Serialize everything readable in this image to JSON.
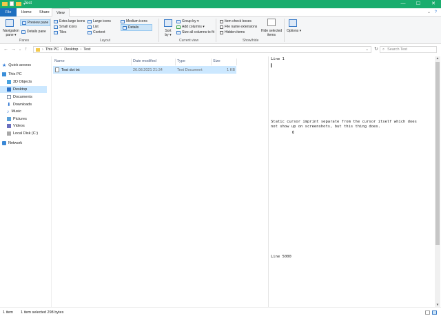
{
  "window": {
    "title": "Test",
    "controls": [
      "—",
      "☐",
      "✕"
    ]
  },
  "ribbon_tabs": [
    {
      "label": "File"
    },
    {
      "label": "Home"
    },
    {
      "label": "Share"
    },
    {
      "label": "View"
    }
  ],
  "ribbon": {
    "panes": {
      "navigation_pane": "Navigation pane ▾",
      "preview_pane": "Preview pane",
      "details_pane": "Details pane",
      "group_label": "Panes"
    },
    "layout": {
      "items": [
        "Extra large icons",
        "Large icons",
        "Medium icons",
        "Small icons",
        "List",
        "Details",
        "Tiles",
        "Content"
      ],
      "selected": "Details",
      "group_label": "Layout"
    },
    "current_view": {
      "sort_by": "Sort by ▾",
      "group_by": "Group by ▾",
      "add_columns": "Add columns ▾",
      "size_all": "Size all columns to fit",
      "group_label": "Current view"
    },
    "show_hide": {
      "item_checkboxes": "Item check boxes",
      "file_name_extensions": "File name extensions",
      "hidden_items": "Hidden items",
      "hide_selected": "Hide selected items",
      "group_label": "Show/hide"
    },
    "options": "Options ▾"
  },
  "address": {
    "crumbs": [
      "This PC",
      "Desktop",
      "Test"
    ],
    "search_placeholder": "Search Test"
  },
  "sidebar": {
    "items": [
      {
        "label": "Quick access",
        "icon": "star-icon",
        "color": "#2f7ad6"
      },
      {
        "label": "This PC",
        "icon": "computer-icon",
        "color": "#3b8fd9"
      },
      {
        "label": "3D Objects",
        "icon": "cube-icon",
        "color": "#4aa3df"
      },
      {
        "label": "Desktop",
        "icon": "desktop-icon",
        "color": "#2d73c8",
        "selected": true
      },
      {
        "label": "Documents",
        "icon": "document-icon",
        "color": "#7a8aa0"
      },
      {
        "label": "Downloads",
        "icon": "download-icon",
        "color": "#2a74d0"
      },
      {
        "label": "Music",
        "icon": "music-icon",
        "color": "#3b7dd8"
      },
      {
        "label": "Pictures",
        "icon": "picture-icon",
        "color": "#5aa0d8"
      },
      {
        "label": "Videos",
        "icon": "video-icon",
        "color": "#6a6fbf"
      },
      {
        "label": "Local Disk (C:)",
        "icon": "disk-icon",
        "color": "#8a8a8a"
      },
      {
        "label": "Network",
        "icon": "network-icon",
        "color": "#3a88d6"
      }
    ]
  },
  "filelist": {
    "columns": [
      "Name",
      "Date modified",
      "Type",
      "Size"
    ],
    "rows": [
      {
        "name": "Test dot txt",
        "date": "26.08.2021 21:34",
        "type": "Text Document",
        "size": "1 KB"
      }
    ]
  },
  "preview": {
    "line1": "Line 1",
    "middle": "Static cursor imprint separate from the cursor itself which does not show up on screenshots, but this thing does.",
    "cursor_glyph": "⇕",
    "last": "Line 5000"
  },
  "status": {
    "items": "1 item",
    "selected": "1 item selected  298 bytes"
  }
}
